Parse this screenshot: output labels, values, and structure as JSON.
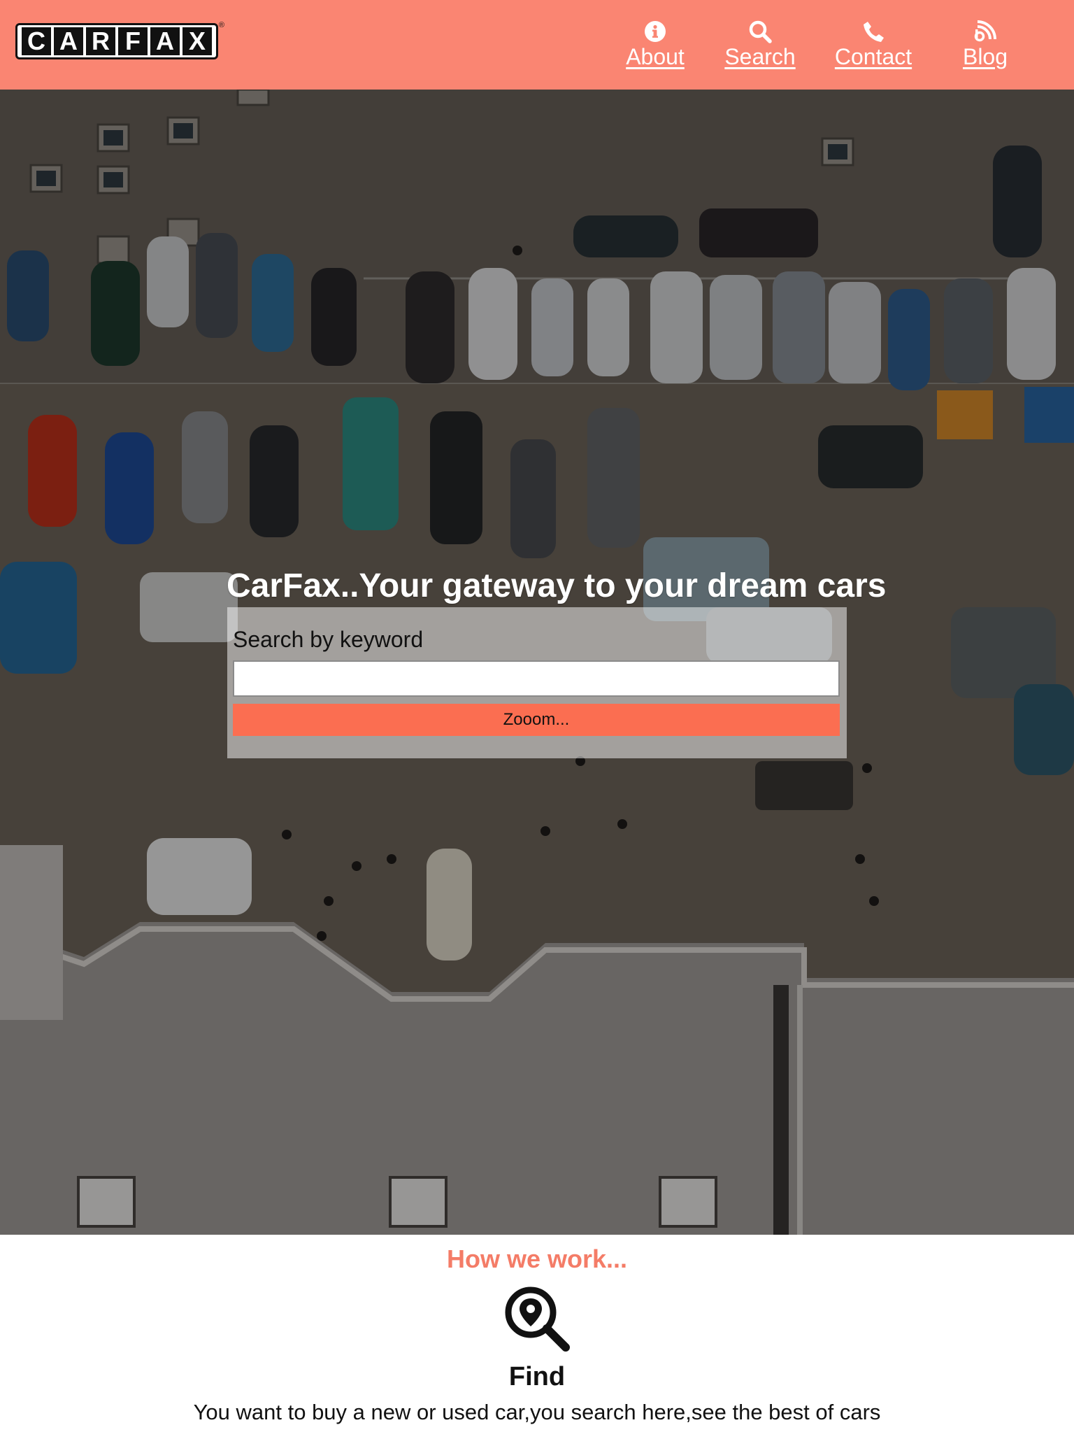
{
  "header": {
    "logo_letters": [
      "C",
      "A",
      "R",
      "F",
      "A",
      "X"
    ],
    "logo_registered": "®",
    "nav": [
      {
        "label": "About",
        "icon": "info-circle-icon"
      },
      {
        "label": "Search",
        "icon": "search-icon"
      },
      {
        "label": "Contact",
        "icon": "phone-icon"
      },
      {
        "label": "Blog",
        "icon": "rss-icon"
      }
    ]
  },
  "hero": {
    "title": "CarFax..Your gateway to your dream cars",
    "search_label": "Search by keyword",
    "search_value": "",
    "search_button": "Zooom..."
  },
  "how_we_work": {
    "title": "How we work...",
    "steps": [
      {
        "icon": "location-search-icon",
        "title": "Find",
        "text": "You want to buy a new or used car,you search here,see the best of cars"
      }
    ]
  },
  "colors": {
    "header_bg": "#fa8572",
    "button_bg": "#fb6e51",
    "section_title": "#f47c67"
  }
}
